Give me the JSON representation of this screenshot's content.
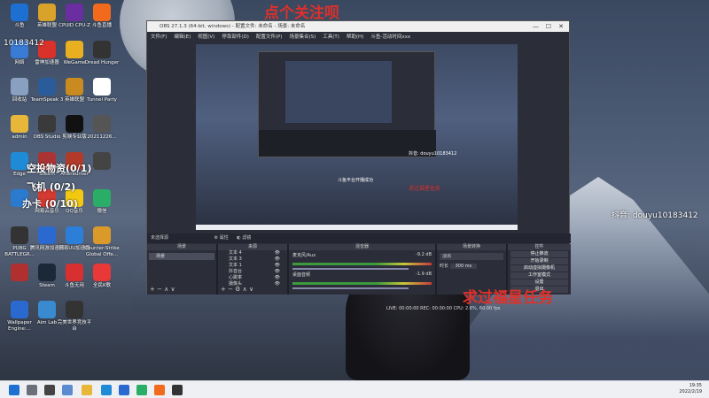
{
  "desktop": {
    "icons": [
      {
        "label": "斗鱼",
        "color": "#1d6fd1"
      },
      {
        "label": "英雄联盟",
        "color": "#d9a22a"
      },
      {
        "label": "CPUID CPU-Z",
        "color": "#6a2ea0"
      },
      {
        "label": "斗鱼直播",
        "color": "#f26a1b"
      },
      {
        "label": "网络",
        "color": "#3a7bd5"
      },
      {
        "label": "雷神加速器",
        "color": "#d8322a"
      },
      {
        "label": "WeGame",
        "color": "#e8b020"
      },
      {
        "label": "Dread Hunger",
        "color": "#333333"
      },
      {
        "label": "回收站",
        "color": "#8aa0c0"
      },
      {
        "label": "TeamSpeak 3",
        "color": "#2a5c9a"
      },
      {
        "label": "英雄联盟",
        "color": "#c98a20"
      },
      {
        "label": "Tunnel Party",
        "color": "#ffffff"
      },
      {
        "label": "admin",
        "color": "#e8b73a"
      },
      {
        "label": "OBS Studio",
        "color": "#3a3a3a"
      },
      {
        "label": "剪映专业版",
        "color": "#111111"
      },
      {
        "label": "20211226...",
        "color": "#555555"
      },
      {
        "label": "Edge",
        "color": "#1f8bd6"
      },
      {
        "label": "Steam",
        "color": "#a33"
      },
      {
        "label": "Afterburner",
        "color": "#b23a2a"
      },
      {
        "label": "",
        "color": "#444444"
      },
      {
        "label": "",
        "color": "#2a7ad0"
      },
      {
        "label": "网易云音乐",
        "color": "#d33a31"
      },
      {
        "label": "QQ音乐",
        "color": "#f2c811"
      },
      {
        "label": "微信",
        "color": "#2aae67"
      },
      {
        "label": "PUBG BATTLEGR...",
        "color": "#333333"
      },
      {
        "label": "腾讯网游加速器",
        "color": "#2a6ad0"
      },
      {
        "label": "网易UU加速器",
        "color": "#2b7fd9"
      },
      {
        "label": "Counter-Strike Global Offe...",
        "color": "#d99a2a"
      },
      {
        "label": "",
        "color": "#b03030"
      },
      {
        "label": "Steam",
        "color": "#1b2838"
      },
      {
        "label": "斗鱼无用",
        "color": "#d83030"
      },
      {
        "label": "全民K歌",
        "color": "#e83838"
      },
      {
        "label": "Wallpaper Engine:...",
        "color": "#2a6ad0"
      },
      {
        "label": "Aim Lab",
        "color": "#3a8ad0"
      },
      {
        "label": "完美世界竞技平台",
        "color": "#333333"
      }
    ],
    "overlay_left": [
      "空投物资(0/1)",
      "飞机 (0/2)",
      "办卡 (0/10)"
    ],
    "id_text": "10183412"
  },
  "overlay": {
    "top_text": "点个关注呗",
    "bottom_text": "求过福星任务",
    "tiktok": "抖音: douyu10183412"
  },
  "obs": {
    "title": "OBS 27.1.3 (64-bit, windows) - 配置文件: 未命名 - 场景: 未命名",
    "menu": [
      "文件(F)",
      "编辑(E)",
      "视图(V)",
      "停靠部件(D)",
      "配置文件(P)",
      "场景集合(S)",
      "工具(T)",
      "帮助(H)",
      "斗鱼-活动时间xxx"
    ],
    "toolbar_label": "未选择源",
    "toolbar_props": "属性",
    "toolbar_filters": "滤镜",
    "panels": {
      "scenes": "场景",
      "sources": "来源",
      "mixer": "混音器",
      "transitions": "场景转换",
      "controls": "控件"
    },
    "scene_item": "场景",
    "sources": [
      "文本 4",
      "文本 3",
      "文本 1",
      "抖音台",
      "心跳率",
      "摄像头"
    ],
    "mixer_channels": [
      {
        "name": "麦克风/Aux",
        "db": "-9.2 dB"
      },
      {
        "name": "桌面音频",
        "db": "-1.9 dB"
      }
    ],
    "transition": "淡出",
    "duration_label": "时长",
    "duration": "300 ms",
    "controls": [
      "停止推流",
      "开始录制",
      "启动虚拟摄像机",
      "工作室模式",
      "设置",
      "退出"
    ],
    "status": "LIVE: 00:00:00   REC: 00:00:00   CPU: 2.6%, 60.00 fps",
    "preview_banner": "斗鱼平台开播成功",
    "preview_overlay": "求过福星任务",
    "preview_tiktok": "抖音: douyu10183412"
  },
  "taskbar": {
    "time": "19:35",
    "date": "2022/2/19"
  }
}
